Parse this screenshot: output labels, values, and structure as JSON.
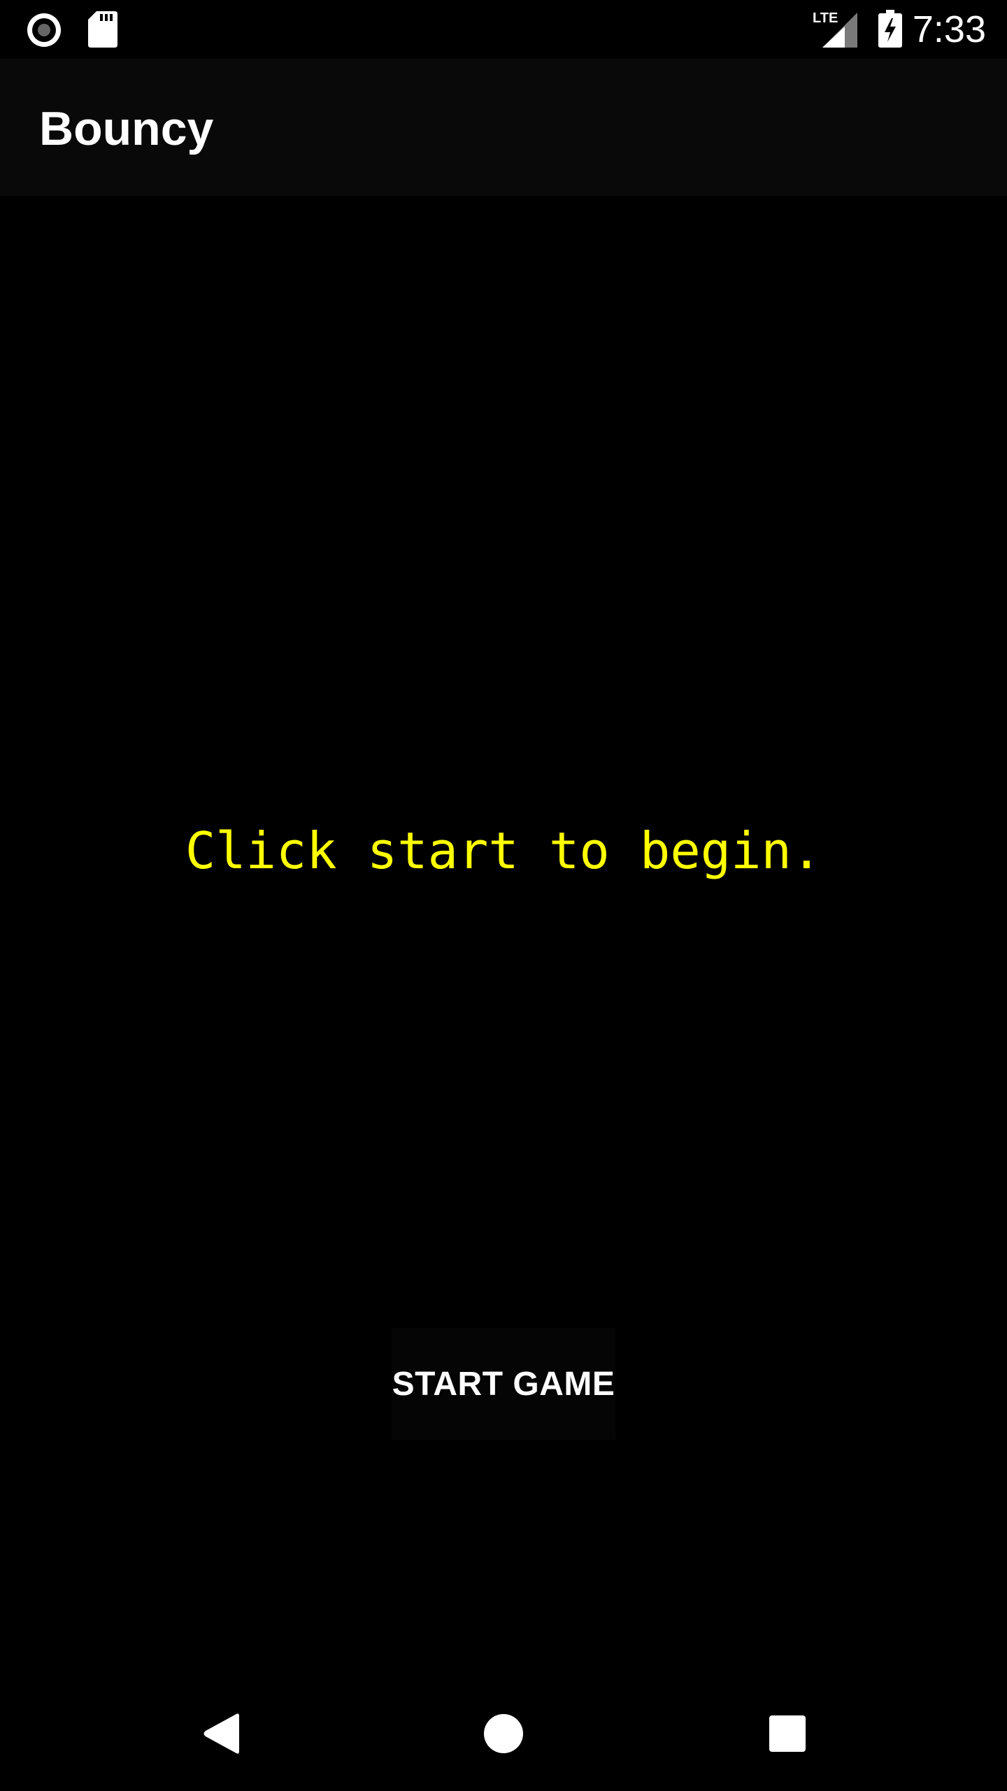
{
  "status_bar": {
    "time": "7:33",
    "network": "LTE",
    "icons": [
      "recording-icon",
      "sd-card-icon",
      "lte-signal-icon",
      "battery-charging-icon"
    ]
  },
  "app_bar": {
    "title": "Bouncy"
  },
  "main": {
    "message": "Click start to begin.",
    "message_color": "#ffff00",
    "start_button_label": "START GAME"
  },
  "nav_bar": {
    "icons": [
      "back-icon",
      "home-icon",
      "recents-icon"
    ]
  }
}
